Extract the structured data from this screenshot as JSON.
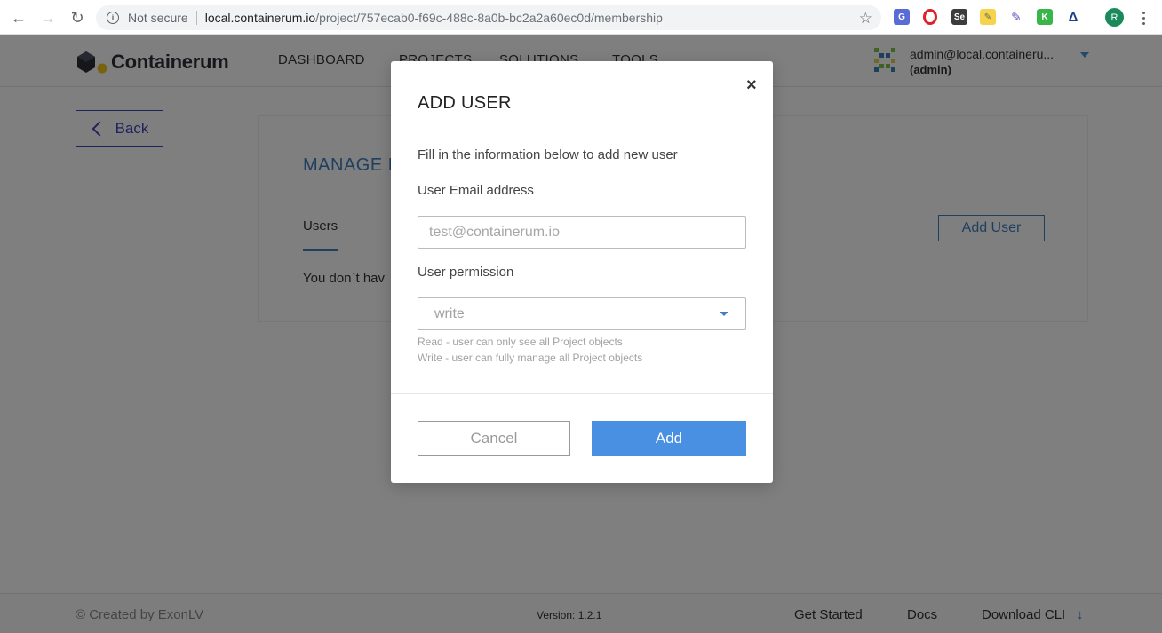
{
  "browser": {
    "security_label": "Not secure",
    "url_host": "local.containerum.io",
    "url_path": "/project/757ecab0-f69c-488c-8a0b-bc2a2a60ec0d/membership",
    "profile_initial": "R"
  },
  "header": {
    "logo_text": "Containerum",
    "nav": [
      "DASHBOARD",
      "PROJECTS",
      "SOLUTIONS",
      "TOOLS"
    ],
    "user_email": "admin@local.containeru...",
    "user_role": "(admin)"
  },
  "page": {
    "back_label": "Back",
    "panel_title": "MANAGE P",
    "tab_users": "Users",
    "add_user_label": "Add User",
    "empty_text": "You don`t hav"
  },
  "modal": {
    "title": "ADD USER",
    "close_symbol": "×",
    "description": "Fill in the information below to add new user",
    "email_label": "User Email address",
    "email_placeholder": "test@containerum.io",
    "email_value": "",
    "permission_label": "User permission",
    "permission_value": "write",
    "hint_read": "Read - user can only see all Project objects",
    "hint_write": "Write - user can fully manage all Project objects",
    "cancel_label": "Cancel",
    "add_label": "Add"
  },
  "footer": {
    "copyright": "© Created by ExonLV",
    "version": "Version: 1.2.1",
    "get_started": "Get Started",
    "docs": "Docs",
    "download_cli": "Download CLI"
  },
  "colors": {
    "accent": "#3f7fbf",
    "primary_button": "#4a90e2",
    "back_button": "#3f46b8"
  }
}
